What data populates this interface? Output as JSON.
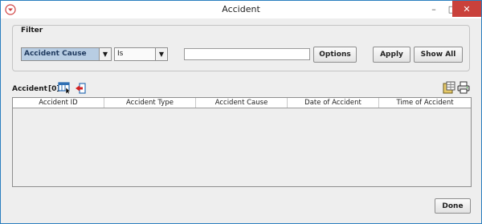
{
  "window": {
    "title": "Accident"
  },
  "filter": {
    "legend": "Filter",
    "field_value": "Accident Cause",
    "operator_value": "Is",
    "text_value": "",
    "options_label": "Options",
    "apply_label": "Apply",
    "show_all_label": "Show All"
  },
  "section": {
    "label": "Accident",
    "count": "[0]"
  },
  "table": {
    "columns": [
      "Accident ID",
      "Accident Type",
      "Accident Cause",
      "Date of Accident",
      "Time of Accident"
    ],
    "rows": []
  },
  "footer": {
    "done_label": "Done"
  },
  "icons": {
    "app": "app-menu-icon",
    "select_columns": "select-columns-icon",
    "export": "export-icon",
    "export_grid": "export-grid-icon",
    "print": "printer-icon"
  },
  "colors": {
    "close_button": "#c9413b",
    "selected_combo": "#b8cde3"
  }
}
